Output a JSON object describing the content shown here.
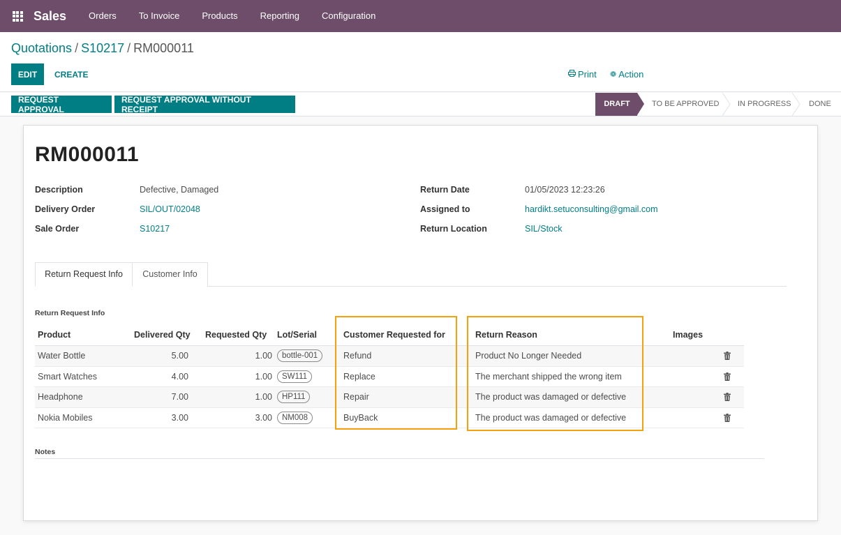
{
  "navbar": {
    "brand": "Sales",
    "menu": [
      "Orders",
      "To Invoice",
      "Products",
      "Reporting",
      "Configuration"
    ],
    "apps_icon": "grid-apps-icon"
  },
  "breadcrumb": {
    "items": [
      "Quotations",
      "S10217"
    ],
    "current": "RM000011",
    "separator": "/"
  },
  "control": {
    "edit_label": "EDIT",
    "create_label": "CREATE",
    "print_label": "Print",
    "action_label": "Action",
    "print_icon": "print-icon",
    "action_icon": "gear-icon"
  },
  "statusbar": {
    "buttons": [
      "REQUEST APPROVAL",
      "REQUEST APPROVAL WITHOUT RECEIPT"
    ],
    "stages": [
      "DRAFT",
      "TO BE APPROVED",
      "IN PROGRESS",
      "DONE"
    ],
    "active_stage": "DRAFT"
  },
  "record": {
    "title": "RM000011",
    "left_fields": [
      {
        "label": "Description",
        "value": "Defective, Damaged"
      },
      {
        "label": "Delivery Order",
        "value": "SIL/OUT/02048"
      },
      {
        "label": "Sale Order",
        "value": "S10217"
      }
    ],
    "right_fields": [
      {
        "label": "Return Date",
        "value": "01/05/2023 12:23:26"
      },
      {
        "label": "Assigned to",
        "value": "hardikt.setuconsulting@gmail.com"
      },
      {
        "label": "Return Location",
        "value": "SIL/Stock"
      }
    ]
  },
  "tabs": [
    "Return Request Info",
    "Customer Info"
  ],
  "section_title": "Return Request Info",
  "table": {
    "columns": [
      "Product",
      "Delivered Qty",
      "Requested Qty",
      "Lot/Serial",
      "Customer Requested for",
      "Return Reason",
      "Images"
    ],
    "rows": [
      {
        "product": "Water Bottle",
        "delivered": "5.00",
        "requested": "1.00",
        "lot": "bottle-001",
        "customer_req": "Refund",
        "reason": "Product No Longer Needed"
      },
      {
        "product": "Smart Watches",
        "delivered": "4.00",
        "requested": "1.00",
        "lot": "SW111",
        "customer_req": "Replace",
        "reason": "The merchant shipped the wrong item"
      },
      {
        "product": "Headphone",
        "delivered": "7.00",
        "requested": "1.00",
        "lot": "HP111",
        "customer_req": "Repair",
        "reason": "The product was damaged or defective"
      },
      {
        "product": "Nokia Mobiles",
        "delivered": "3.00",
        "requested": "3.00",
        "lot": "NM008",
        "customer_req": "BuyBack",
        "reason": "The product was damaged or defective"
      }
    ],
    "delete_icon": "trash-icon"
  },
  "notes_label": "Notes",
  "colors": {
    "navbar": "#6e4d6a",
    "primary": "#017e84",
    "highlight": "#f5a10b"
  }
}
